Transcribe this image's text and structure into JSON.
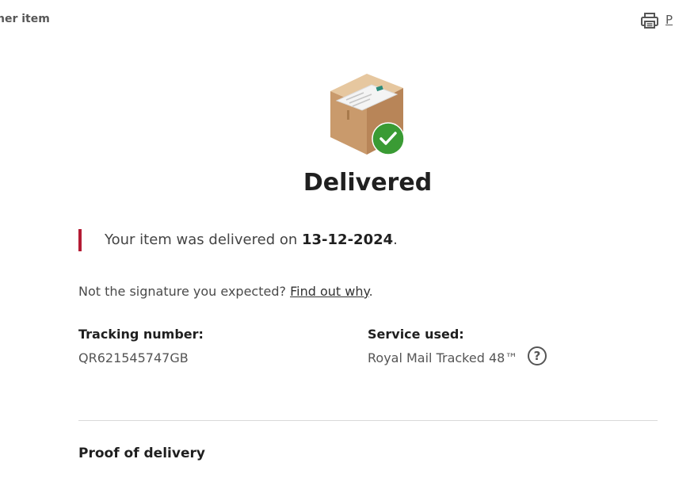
{
  "header": {
    "back_link": "her item",
    "print_label": "P"
  },
  "status": {
    "title": "Delivered",
    "icons": [
      "package-icon",
      "check-icon"
    ],
    "colors": {
      "accent_red": "#b41b34",
      "success_green": "#3a9b34"
    }
  },
  "notice": {
    "prefix": "Your item was delivered on ",
    "date": "13-12-2024",
    "suffix": "."
  },
  "signature": {
    "text": "Not the signature you expected? ",
    "link": "Find out why",
    "suffix": "."
  },
  "details": {
    "tracking_label": "Tracking number:",
    "tracking_value": "QR621545747GB",
    "service_label": "Service used:",
    "service_value": "Royal Mail Tracked 48™",
    "help_symbol": "?"
  },
  "proof": {
    "title": "Proof of delivery"
  }
}
